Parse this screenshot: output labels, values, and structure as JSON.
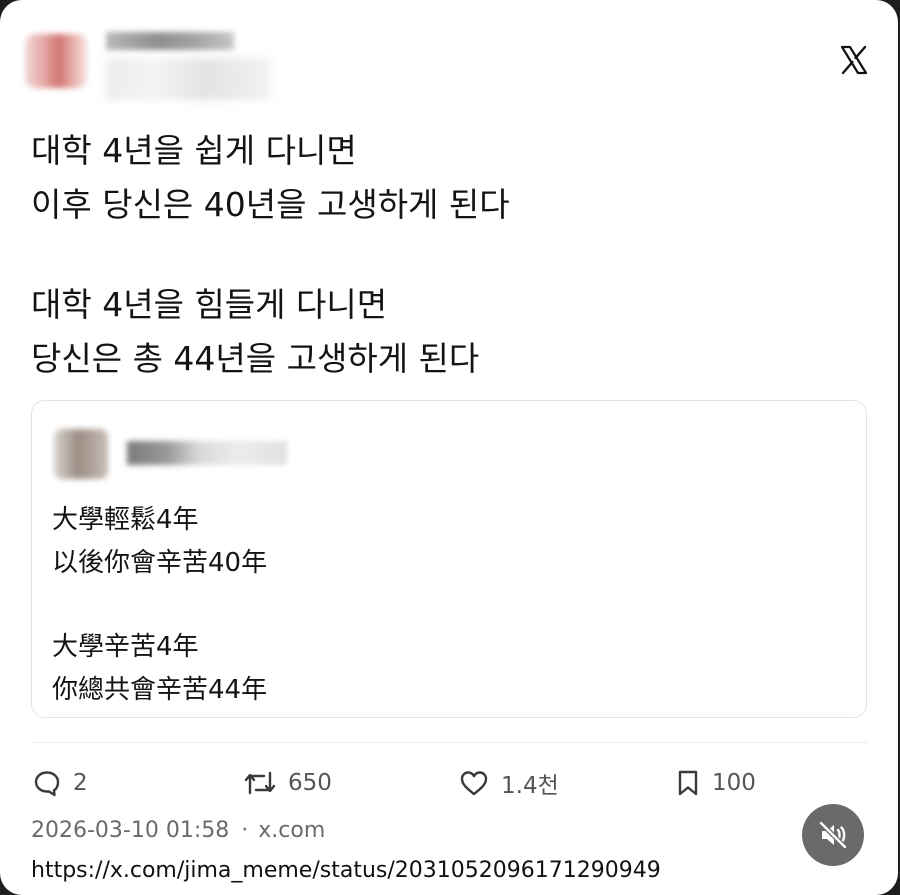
{
  "post": {
    "lines_block1": [
      "대학 4년을 쉽게 다니면",
      "이후 당신은 40년을 고생하게 된다"
    ],
    "lines_block2": [
      "대학 4년을 힘들게 다니면",
      "당신은 총 44년을 고생하게 된다"
    ]
  },
  "quoted": {
    "lines_block1": [
      "大學輕鬆4年",
      "以後你會辛苦40年"
    ],
    "lines_block2": [
      "大學辛苦4年",
      "你總共會辛苦44年"
    ]
  },
  "actions": {
    "reply_count": "2",
    "repost_count": "650",
    "like_count": "1.4천",
    "bookmark_count": "100"
  },
  "meta": {
    "timestamp": "2026-03-10 01:58",
    "separator": "·",
    "source": "x.com",
    "url": "https://x.com/jima_meme/status/2031052096171290949"
  },
  "icons": {
    "platform": "x-logo-icon",
    "reply": "speech-bubble-icon",
    "repost": "repost-arrows-icon",
    "like": "heart-icon",
    "bookmark": "bookmark-icon",
    "mute": "speaker-muted-icon"
  },
  "colors": {
    "text": "#141414",
    "muted": "#555555",
    "mute_button": "#6a6a6a"
  }
}
